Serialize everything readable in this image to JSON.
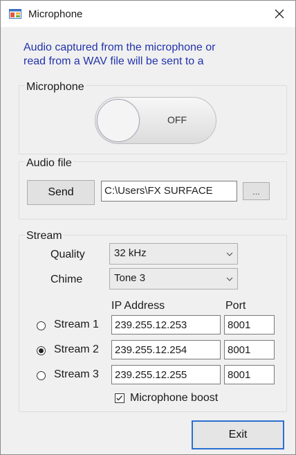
{
  "window": {
    "title": "Microphone",
    "close_icon": "close-icon",
    "app_icon": "app-window-icon"
  },
  "intro": {
    "line1": "Audio captured from the microphone or",
    "line2": "read from a WAV file will be sent to a"
  },
  "microphone_group": {
    "label": "Microphone",
    "toggle_text": "OFF",
    "toggle_on": false
  },
  "audio_file_group": {
    "label": "Audio file",
    "send_label": "Send",
    "path_value": "C:\\Users\\FX SURFACE",
    "browse_label": "..."
  },
  "stream_group": {
    "label": "Stream",
    "quality_label": "Quality",
    "quality_value": "32 kHz",
    "chime_label": "Chime",
    "chime_value": "Tone 3",
    "ip_header": "IP Address",
    "port_header": "Port",
    "streams": [
      {
        "label": "Stream 1",
        "ip": "239.255.12.253",
        "port": "8001",
        "selected": false
      },
      {
        "label": "Stream 2",
        "ip": "239.255.12.254",
        "port": "8001",
        "selected": true
      },
      {
        "label": "Stream 3",
        "ip": "239.255.12.255",
        "port": "8001",
        "selected": false
      }
    ],
    "boost_label": "Microphone boost",
    "boost_checked": true
  },
  "footer": {
    "exit_label": "Exit"
  },
  "colors": {
    "intro_text": "#2233aa",
    "background": "#f0f0f0",
    "button": "#e1e1e1",
    "focus_border": "#2a6fd1"
  }
}
